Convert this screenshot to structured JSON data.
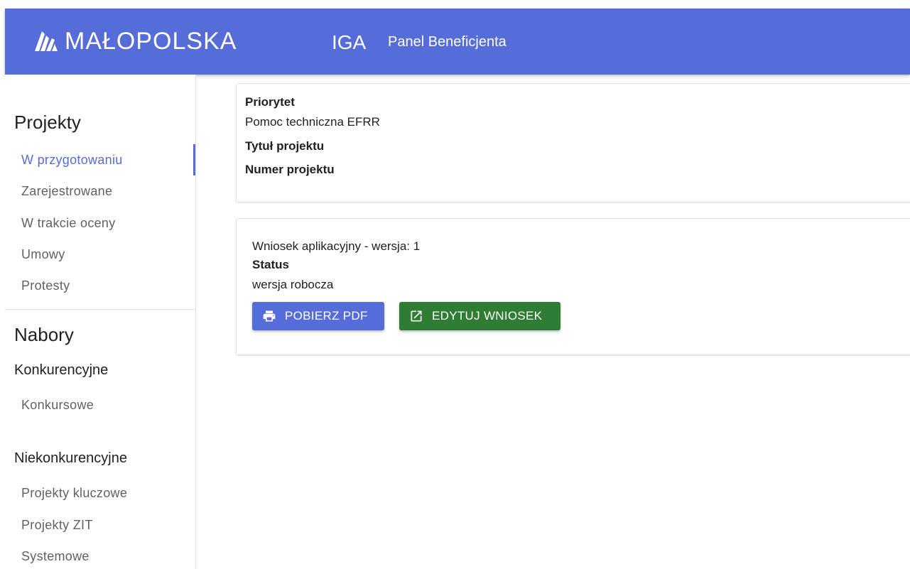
{
  "header": {
    "brand": "MAŁOPOLSKA",
    "app_name": "IGA",
    "app_subtitle": "Panel Beneficjenta",
    "colors": {
      "accent": "#566cd8"
    }
  },
  "sidebar": {
    "projects_heading": "Projekty",
    "project_items": [
      "W przygotowaniu",
      "Zarejestrowane",
      "W trakcie oceny",
      "Umowy",
      "Protesty"
    ],
    "active_item": "W przygotowaniu",
    "calls_heading": "Nabory",
    "competitive_heading": "Konkurencyjne",
    "competitive_items": [
      "Konkursowe"
    ],
    "noncompetitive_heading": "Niekonkurencyjne",
    "noncompetitive_items": [
      "Projekty kluczowe",
      "Projekty ZIT",
      "Systemowe"
    ]
  },
  "project_card": {
    "priority_label": "Priorytet",
    "priority_value": "Pomoc techniczna EFRR",
    "title_label": "Tytuł projektu",
    "number_label": "Numer projektu"
  },
  "application_card": {
    "version_text": "Wniosek aplikacyjny - wersja: 1",
    "status_label": "Status",
    "status_value": "wersja robocza",
    "pdf_button": "POBIERZ PDF",
    "pdf_icon": "printer-icon",
    "edit_button": "EDYTUJ WNIOSEK",
    "edit_icon": "open-external-icon",
    "colors": {
      "pdf": "#566cd8",
      "edit": "#2e7d32"
    }
  }
}
